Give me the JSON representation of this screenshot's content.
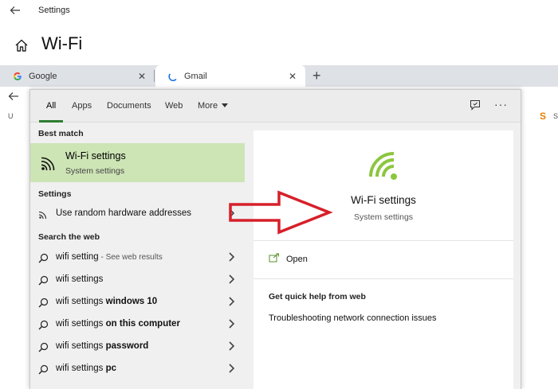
{
  "settings": {
    "window_title": "Settings",
    "page_title": "Wi-Fi"
  },
  "browser": {
    "tabs": [
      {
        "label": "Google",
        "close": "✕"
      },
      {
        "label": "Gmail",
        "close": "✕"
      }
    ],
    "new_tab": "+",
    "bookmark_left": "U",
    "bookmark_right_icon": "S",
    "bookmark_right_text": "S"
  },
  "search": {
    "filters": [
      "All",
      "Apps",
      "Documents",
      "Web",
      "More"
    ],
    "active_filter": "All",
    "more_menu": "···",
    "best_match_heading": "Best match",
    "best_match": {
      "title": "Wi-Fi settings",
      "subtitle": "System settings"
    },
    "settings_heading": "Settings",
    "settings_items": [
      {
        "label": "Use random hardware addresses"
      }
    ],
    "web_heading": "Search the web",
    "web_items": [
      {
        "prefix": "wifi setting",
        "bold": "",
        "suffix": " - See web results"
      },
      {
        "prefix": "wifi settings",
        "bold": "",
        "suffix": ""
      },
      {
        "prefix": "wifi settings ",
        "bold": "windows 10",
        "suffix": ""
      },
      {
        "prefix": "wifi settings ",
        "bold": "on this computer",
        "suffix": ""
      },
      {
        "prefix": "wifi settings ",
        "bold": "password",
        "suffix": ""
      },
      {
        "prefix": "wifi settings ",
        "bold": "pc",
        "suffix": ""
      }
    ]
  },
  "preview": {
    "title": "Wi-Fi settings",
    "subtitle": "System settings",
    "open_label": "Open",
    "help_heading": "Get quick help from web",
    "help_link": "Troubleshooting network connection issues"
  },
  "colors": {
    "accent_green": "#8cc63f",
    "highlight_bg": "#cde4b5",
    "annotation_red": "#d6202a"
  }
}
